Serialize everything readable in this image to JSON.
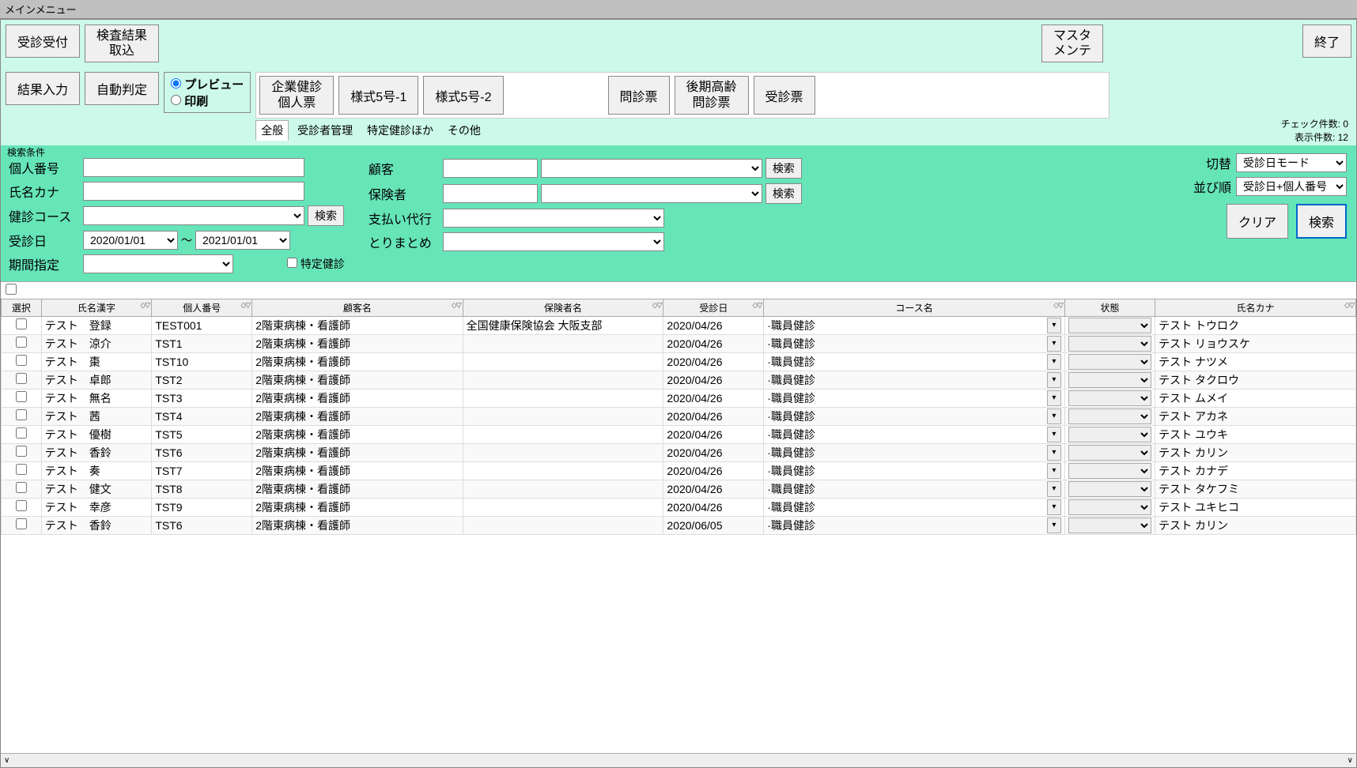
{
  "window": {
    "title": "メインメニュー"
  },
  "toolbar": {
    "reception": "受診受付",
    "import_results": "検査結果\n取込",
    "master_maint": "マスタ\nメンテ",
    "exit": "終了",
    "result_entry": "結果入力",
    "auto_judge": "自動判定"
  },
  "radio": {
    "preview": "プレビュー",
    "print": "印刷"
  },
  "forms": {
    "kigyo": "企業健診\n個人票",
    "style5_1": "様式5号-1",
    "style5_2": "様式5号-2",
    "monshin": "問診票",
    "kouki": "後期高齢\n問診票",
    "jushin": "受診票"
  },
  "tabs": {
    "general": "全般",
    "patient_mgmt": "受診者管理",
    "tokutei": "特定健診ほか",
    "other": "その他"
  },
  "counts": {
    "check": "チェック件数: 0",
    "display": "表示件数: 12"
  },
  "search": {
    "caption": "検索条件",
    "personal_no": "個人番号",
    "name_kana": "氏名カナ",
    "course": "健診コース",
    "exam_date": "受診日",
    "date_from": "2020/01/01",
    "date_to": "2021/01/01",
    "date_sep": "～",
    "period": "期間指定",
    "tokutei_chk": "特定健診",
    "customer": "顧客",
    "insurer": "保険者",
    "pay_agent": "支払い代行",
    "summary": "とりまとめ",
    "search_btn": "検索",
    "switch_lbl": "切替",
    "switch_val": "受診日モード",
    "sort_lbl": "並び順",
    "sort_val": "受診日+個人番号",
    "clear_btn": "クリア"
  },
  "columns": {
    "select": "選択",
    "name_kanji": "氏名漢字",
    "personal_no": "個人番号",
    "customer_name": "顧客名",
    "insurer_name": "保険者名",
    "exam_date": "受診日",
    "course_name": "コース名",
    "status": "状態",
    "name_kana": "氏名カナ"
  },
  "rows": [
    {
      "name": "テスト　登録",
      "no": "TEST001",
      "customer": "2階東病棟・看護師",
      "insurer": "全国健康保険協会 大阪支部",
      "date": "2020/04/26",
      "course": "職員健診",
      "kana": "テスト トウロク"
    },
    {
      "name": "テスト　涼介",
      "no": "TST1",
      "customer": "2階東病棟・看護師",
      "insurer": "",
      "date": "2020/04/26",
      "course": "職員健診",
      "kana": "テスト リョウスケ"
    },
    {
      "name": "テスト　棗",
      "no": "TST10",
      "customer": "2階東病棟・看護師",
      "insurer": "",
      "date": "2020/04/26",
      "course": "職員健診",
      "kana": "テスト ナツメ"
    },
    {
      "name": "テスト　卓郎",
      "no": "TST2",
      "customer": "2階東病棟・看護師",
      "insurer": "",
      "date": "2020/04/26",
      "course": "職員健診",
      "kana": "テスト タクロウ"
    },
    {
      "name": "テスト　無名",
      "no": "TST3",
      "customer": "2階東病棟・看護師",
      "insurer": "",
      "date": "2020/04/26",
      "course": "職員健診",
      "kana": "テスト ムメイ"
    },
    {
      "name": "テスト　茜",
      "no": "TST4",
      "customer": "2階東病棟・看護師",
      "insurer": "",
      "date": "2020/04/26",
      "course": "職員健診",
      "kana": "テスト アカネ"
    },
    {
      "name": "テスト　優樹",
      "no": "TST5",
      "customer": "2階東病棟・看護師",
      "insurer": "",
      "date": "2020/04/26",
      "course": "職員健診",
      "kana": "テスト ユウキ"
    },
    {
      "name": "テスト　香鈴",
      "no": "TST6",
      "customer": "2階東病棟・看護師",
      "insurer": "",
      "date": "2020/04/26",
      "course": "職員健診",
      "kana": "テスト カリン"
    },
    {
      "name": "テスト　奏",
      "no": "TST7",
      "customer": "2階東病棟・看護師",
      "insurer": "",
      "date": "2020/04/26",
      "course": "職員健診",
      "kana": "テスト カナデ"
    },
    {
      "name": "テスト　健文",
      "no": "TST8",
      "customer": "2階東病棟・看護師",
      "insurer": "",
      "date": "2020/04/26",
      "course": "職員健診",
      "kana": "テスト タケフミ"
    },
    {
      "name": "テスト　幸彦",
      "no": "TST9",
      "customer": "2階東病棟・看護師",
      "insurer": "",
      "date": "2020/04/26",
      "course": "職員健診",
      "kana": "テスト ユキヒコ"
    },
    {
      "name": "テスト　香鈴",
      "no": "TST6",
      "customer": "2階東病棟・看護師",
      "insurer": "",
      "date": "2020/06/05",
      "course": "職員健診",
      "kana": "テスト カリン"
    }
  ]
}
